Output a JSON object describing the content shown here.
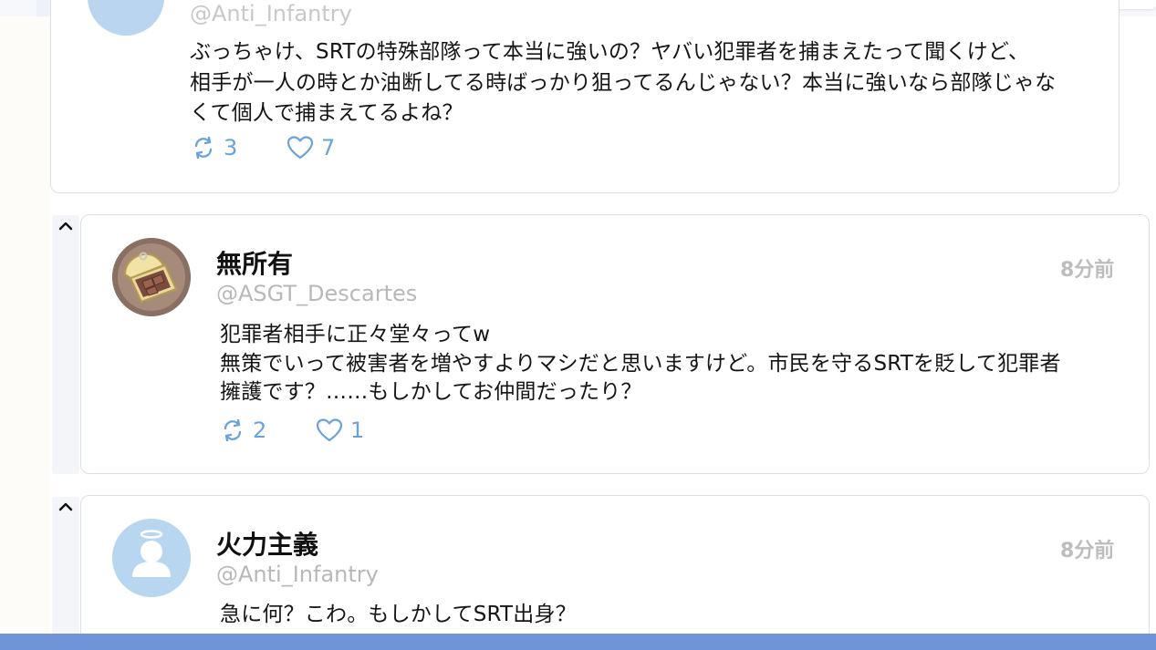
{
  "posts": [
    {
      "handle": "@Anti_Infantry",
      "body": [
        "ぶっちゃけ、SRTの特殊部隊って本当に強いの？ヤバい犯罪者を捕まえたって聞くけど、",
        "相手が一人の時とか油断してる時ばっかり狙ってるんじゃない？本当に強いなら部隊じゃな",
        "くて個人で捕まえてるよね？"
      ],
      "retweets": "3",
      "likes": "7"
    },
    {
      "display_name": "無所有",
      "handle": "@ASGT_Descartes",
      "timestamp": "8分前",
      "body": [
        "犯罪者相手に正々堂々ってw",
        "無策でいって被害者を増やすよりマシだと思いますけど。市民を守るSRTを貶して犯罪者",
        "擁護です？……もしかしてお仲間だったり？"
      ],
      "retweets": "2",
      "likes": "1"
    },
    {
      "display_name": "火力主義",
      "handle": "@Anti_Infantry",
      "timestamp": "8分前",
      "body": [
        "急に何？こわ。もしかしてSRT出身？"
      ]
    }
  ],
  "colors": {
    "accent": "#6aa2dd",
    "bottom_bar": "#6f95d8",
    "muted_text": "#b8b8b8"
  },
  "icons": {
    "retweet": "retweet-icon",
    "like": "heart-icon",
    "collapse": "chevron-up-icon",
    "avatar_default": "person-icon",
    "avatar_custom": "canned-food-icon"
  }
}
